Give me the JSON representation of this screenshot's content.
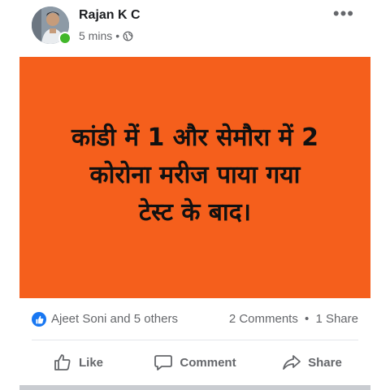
{
  "post": {
    "author": "Rajan K C",
    "time": "5 mins",
    "separator": "•",
    "privacy_icon": "globe-icon",
    "more_icon": "•••",
    "image_text": "कांडी में 1 और सेमौरा में 2\nकोरोना मरीज पाया गया\nटेस्ट के बाद।",
    "image_bg": "#f55f1c"
  },
  "stats": {
    "reactors": "Ajeet Soni and 5 others",
    "comments": "2 Comments",
    "separator": "•",
    "shares": "1 Share"
  },
  "actions": {
    "like": "Like",
    "comment": "Comment",
    "share": "Share"
  },
  "colors": {
    "accent": "#1877f2",
    "online": "#42b72a",
    "muted": "#65676b"
  }
}
